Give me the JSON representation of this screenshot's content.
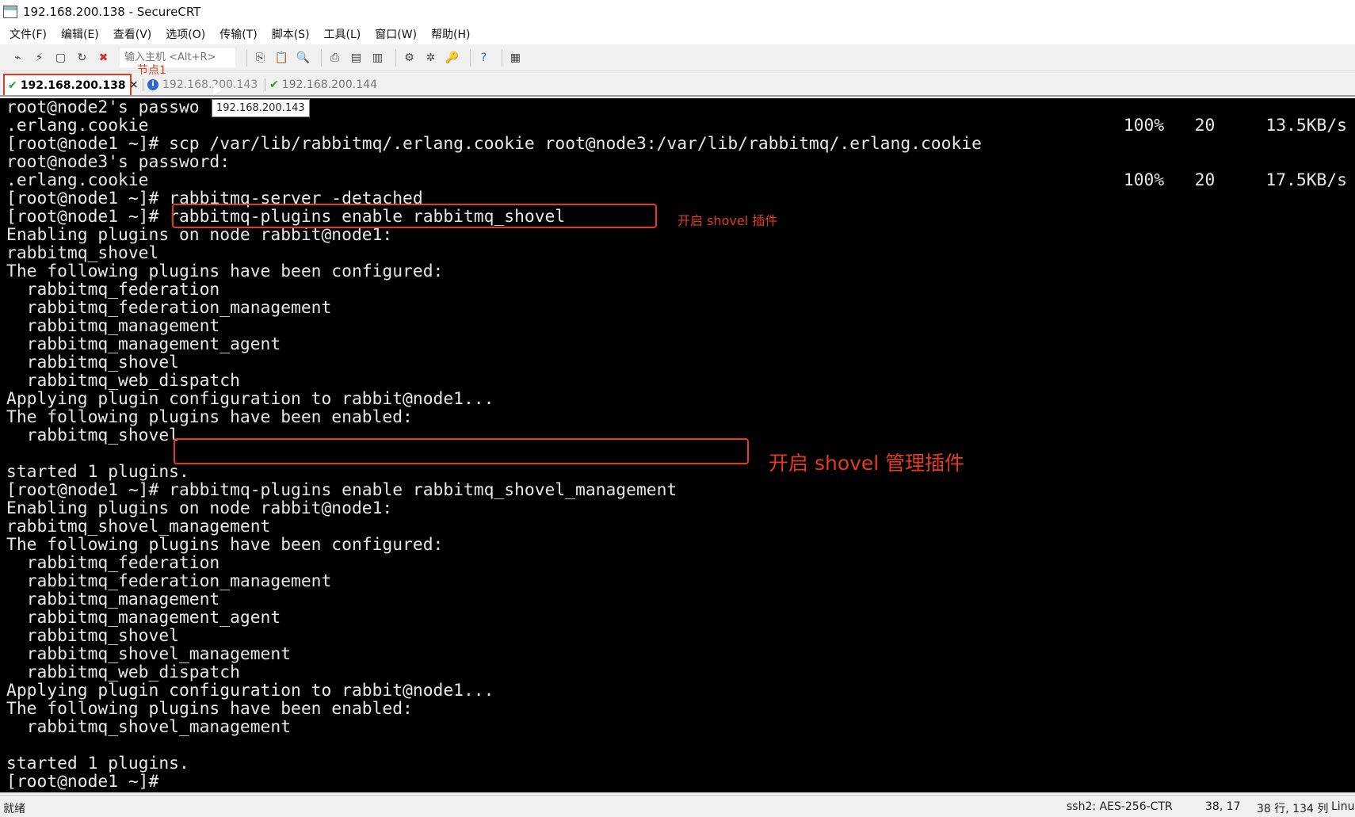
{
  "window": {
    "title": "192.168.200.138 - SecureCRT"
  },
  "menu": {
    "items": [
      "文件(F)",
      "编辑(E)",
      "查看(V)",
      "选项(O)",
      "传输(T)",
      "脚本(S)",
      "工具(L)",
      "窗口(W)",
      "帮助(H)"
    ]
  },
  "toolbar": {
    "host_placeholder": "输入主机 <Alt+R>",
    "icons_left": [
      "connect-icon",
      "quick-connect-icon",
      "connect-in-tab-icon",
      "reconnect-icon",
      "disconnect-icon"
    ],
    "icons_right": [
      "copy-icon",
      "paste-icon",
      "find-icon",
      "print-icon",
      "print-selection-icon",
      "printer-setup-icon",
      "session-options-icon",
      "global-options-icon",
      "keymap-icon",
      "help-icon",
      "map-icon"
    ]
  },
  "tabs": [
    {
      "label": "192.168.200.138",
      "status": "connected",
      "active": true,
      "close": "×"
    },
    {
      "label": "192.168.200.143",
      "status": "info",
      "active": false
    },
    {
      "label": "192.168.200.144",
      "status": "connected",
      "active": false
    }
  ],
  "tooltip": "192.168.200.143",
  "annotations": {
    "node": "节点1",
    "shovel": "开启 shovel 插件",
    "shovel_mgmt": "开启 shovel 管理插件"
  },
  "terminal": {
    "lines": [
      "root@node2's passwo",
      ".erlang.cookie",
      "[root@node1 ~]# scp /var/lib/rabbitmq/.erlang.cookie root@node3:/var/lib/rabbitmq/.erlang.cookie",
      "root@node3's password:",
      ".erlang.cookie",
      "[root@node1 ~]# rabbitmq-server -detached",
      "[root@node1 ~]# rabbitmq-plugins enable rabbitmq_shovel",
      "Enabling plugins on node rabbit@node1:",
      "rabbitmq_shovel",
      "The following plugins have been configured:",
      "  rabbitmq_federation",
      "  rabbitmq_federation_management",
      "  rabbitmq_management",
      "  rabbitmq_management_agent",
      "  rabbitmq_shovel",
      "  rabbitmq_web_dispatch",
      "Applying plugin configuration to rabbit@node1...",
      "The following plugins have been enabled:",
      "  rabbitmq_shovel",
      "",
      "started 1 plugins.",
      "[root@node1 ~]# rabbitmq-plugins enable rabbitmq_shovel_management",
      "Enabling plugins on node rabbit@node1:",
      "rabbitmq_shovel_management",
      "The following plugins have been configured:",
      "  rabbitmq_federation",
      "  rabbitmq_federation_management",
      "  rabbitmq_management",
      "  rabbitmq_management_agent",
      "  rabbitmq_shovel",
      "  rabbitmq_shovel_management",
      "  rabbitmq_web_dispatch",
      "Applying plugin configuration to rabbit@node1...",
      "The following plugins have been enabled:",
      "  rabbitmq_shovel_management",
      "",
      "started 1 plugins.",
      "[root@node1 ~]# "
    ],
    "transfers": [
      "100%   20     13.5KB/s",
      "100%   20     17.5KB/s"
    ]
  },
  "status": {
    "ready": "就绪",
    "cipher": "ssh2: AES-256-CTR",
    "cursor": "38, 17",
    "size": "38 行, 134 列",
    "os": "Linu"
  }
}
